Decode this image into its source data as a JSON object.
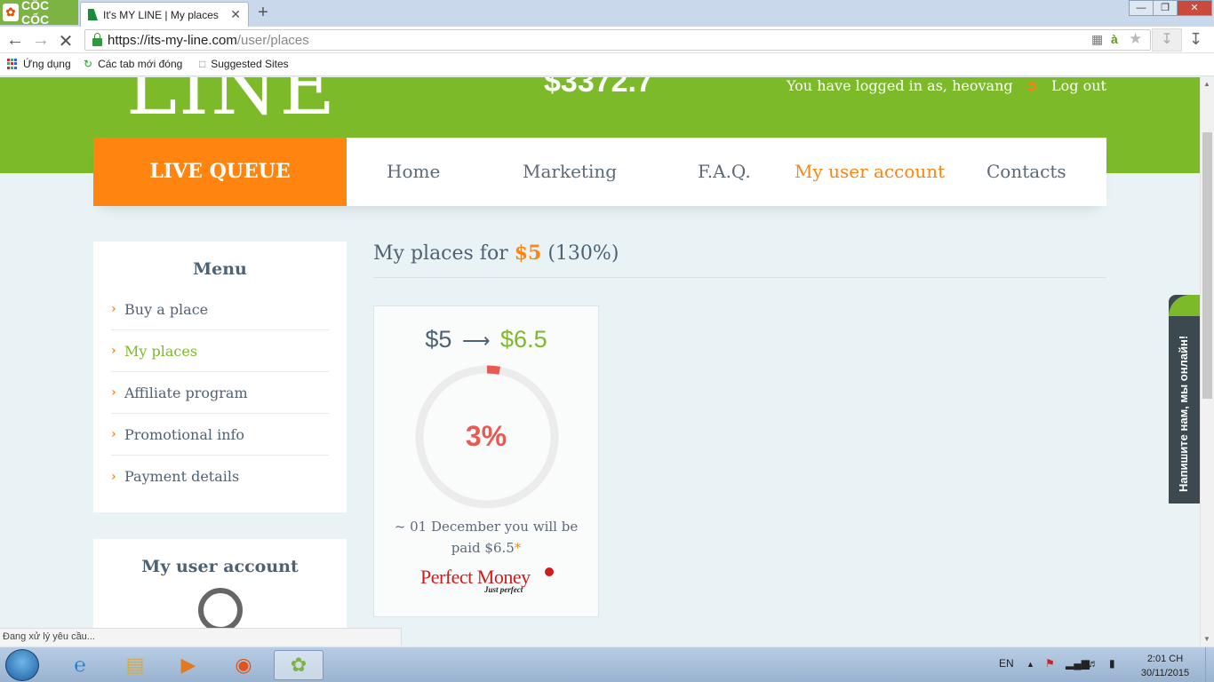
{
  "browser": {
    "logo": "CỐC CỐC",
    "tab_title": "It's MY LINE | My places",
    "url_host": "https://its-my-line.com",
    "url_path": "/user/places",
    "bookmarks": [
      {
        "label": "Ứng dụng"
      },
      {
        "label": "Các tab mới đóng"
      },
      {
        "label": "Suggested Sites"
      }
    ],
    "status_text": "Đang xử lý yêu cầu..."
  },
  "header": {
    "logo_text": "LINE",
    "balance": "$3372.7",
    "logged_in_text": "You have logged in as, heovang",
    "logout_label": "Log out"
  },
  "nav": {
    "live_queue": "LIVE QUEUE",
    "items": [
      {
        "label": "Home"
      },
      {
        "label": "Marketing"
      },
      {
        "label": "F.A.Q."
      },
      {
        "label": "My user account"
      },
      {
        "label": "Contacts"
      }
    ],
    "active_index": 3
  },
  "menu": {
    "title": "Menu",
    "items": [
      {
        "label": "Buy a place"
      },
      {
        "label": "My places"
      },
      {
        "label": "Affiliate program"
      },
      {
        "label": "Promotional info"
      },
      {
        "label": "Payment details"
      }
    ],
    "active_index": 1
  },
  "account_box": {
    "title": "My user account"
  },
  "content": {
    "title_prefix": "My places for",
    "title_amount": "$5",
    "title_suffix": "(130%)"
  },
  "place_card": {
    "from": "$5",
    "to": "$6.5",
    "progress_percent": 3,
    "progress_label": "3%",
    "paid_text": "~ 01 December you will be paid $6.5",
    "asterisk": "*",
    "pm_brand": "Perfect Money",
    "pm_tagline": "Just perfect"
  },
  "chat_widget": {
    "text": "Напишите нам, мы онлайн!"
  },
  "taskbar": {
    "language": "EN",
    "time": "2:01 CH",
    "date": "30/11/2015"
  },
  "colors": {
    "brand_green": "#7cba2a",
    "brand_orange": "#ff8410",
    "progress_red": "#e85a52",
    "text_slate": "#4e6276"
  }
}
